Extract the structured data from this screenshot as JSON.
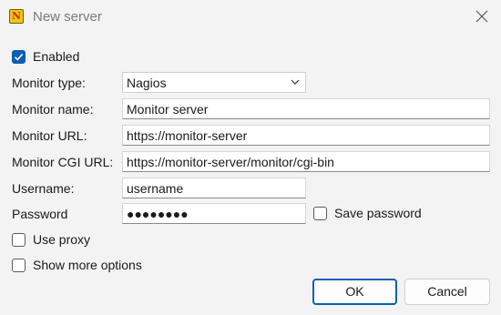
{
  "window": {
    "title": "New server",
    "app_icon_letter": "N"
  },
  "enabled": {
    "label": "Enabled",
    "checked": true
  },
  "fields": {
    "monitor_type": {
      "label": "Monitor type:",
      "value": "Nagios"
    },
    "monitor_name": {
      "label": "Monitor name:",
      "value": "Monitor server"
    },
    "monitor_url": {
      "label": "Monitor URL:",
      "value": "https://monitor-server"
    },
    "monitor_cgi_url": {
      "label": "Monitor CGI URL:",
      "value": "https://monitor-server/monitor/cgi-bin"
    },
    "username": {
      "label": "Username:",
      "value": "username"
    },
    "password": {
      "label": "Password",
      "value": "●●●●●●●●"
    }
  },
  "save_password": {
    "label": "Save password",
    "checked": false
  },
  "use_proxy": {
    "label": "Use proxy",
    "checked": false
  },
  "show_more_options": {
    "label": "Show more options",
    "checked": false
  },
  "buttons": {
    "ok": "OK",
    "cancel": "Cancel"
  },
  "colors": {
    "accent": "#0a5fb4",
    "background": "#f3f3f3"
  },
  "icons": {
    "close": "close-icon",
    "dropdown": "chevron-down-icon",
    "check": "checkmark-icon"
  }
}
